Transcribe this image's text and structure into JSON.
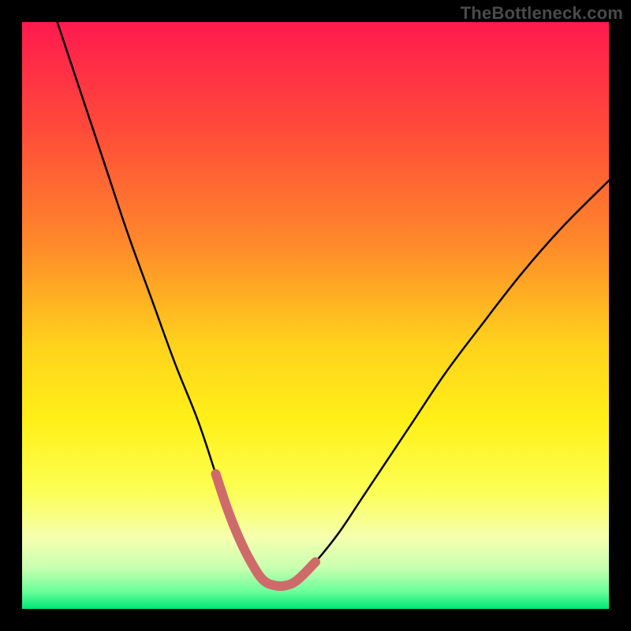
{
  "watermark": "TheBottleneck.com",
  "colors": {
    "frame": "#000000",
    "curve_main": "#000000",
    "curve_accent": "#cf6a6a",
    "gradient_stops": [
      {
        "pct": 0,
        "color": "#ff1a4e"
      },
      {
        "pct": 18,
        "color": "#ff4a3a"
      },
      {
        "pct": 38,
        "color": "#ff8a2a"
      },
      {
        "pct": 55,
        "color": "#ffd21c"
      },
      {
        "pct": 68,
        "color": "#fff018"
      },
      {
        "pct": 80,
        "color": "#fcff55"
      },
      {
        "pct": 88,
        "color": "#f5ffb0"
      },
      {
        "pct": 93,
        "color": "#c8ffb0"
      },
      {
        "pct": 97,
        "color": "#6bff9a"
      },
      {
        "pct": 100,
        "color": "#00e676"
      }
    ]
  },
  "chart_data": {
    "type": "line",
    "title": "",
    "xlabel": "",
    "ylabel": "",
    "xlim": [
      0,
      100
    ],
    "ylim": [
      0,
      100
    ],
    "grid": false,
    "legend": false,
    "series": [
      {
        "name": "bottleneck-curve",
        "x": [
          6,
          10,
          14,
          18,
          22,
          26,
          30,
          33,
          35,
          37,
          39,
          41,
          43,
          45,
          47,
          50,
          54,
          58,
          62,
          66,
          72,
          78,
          85,
          92,
          100
        ],
        "values": [
          100,
          88,
          76,
          64,
          53,
          42,
          32,
          23,
          17,
          12,
          8,
          5,
          4,
          4,
          5,
          8,
          13,
          19,
          25,
          31,
          40,
          48,
          57,
          65,
          73
        ]
      },
      {
        "name": "near-zero-highlight",
        "x": [
          33,
          35,
          37,
          39,
          41,
          43,
          45,
          47,
          50
        ],
        "values": [
          23,
          17,
          12,
          8,
          5,
          4,
          4,
          5,
          8
        ]
      }
    ]
  }
}
